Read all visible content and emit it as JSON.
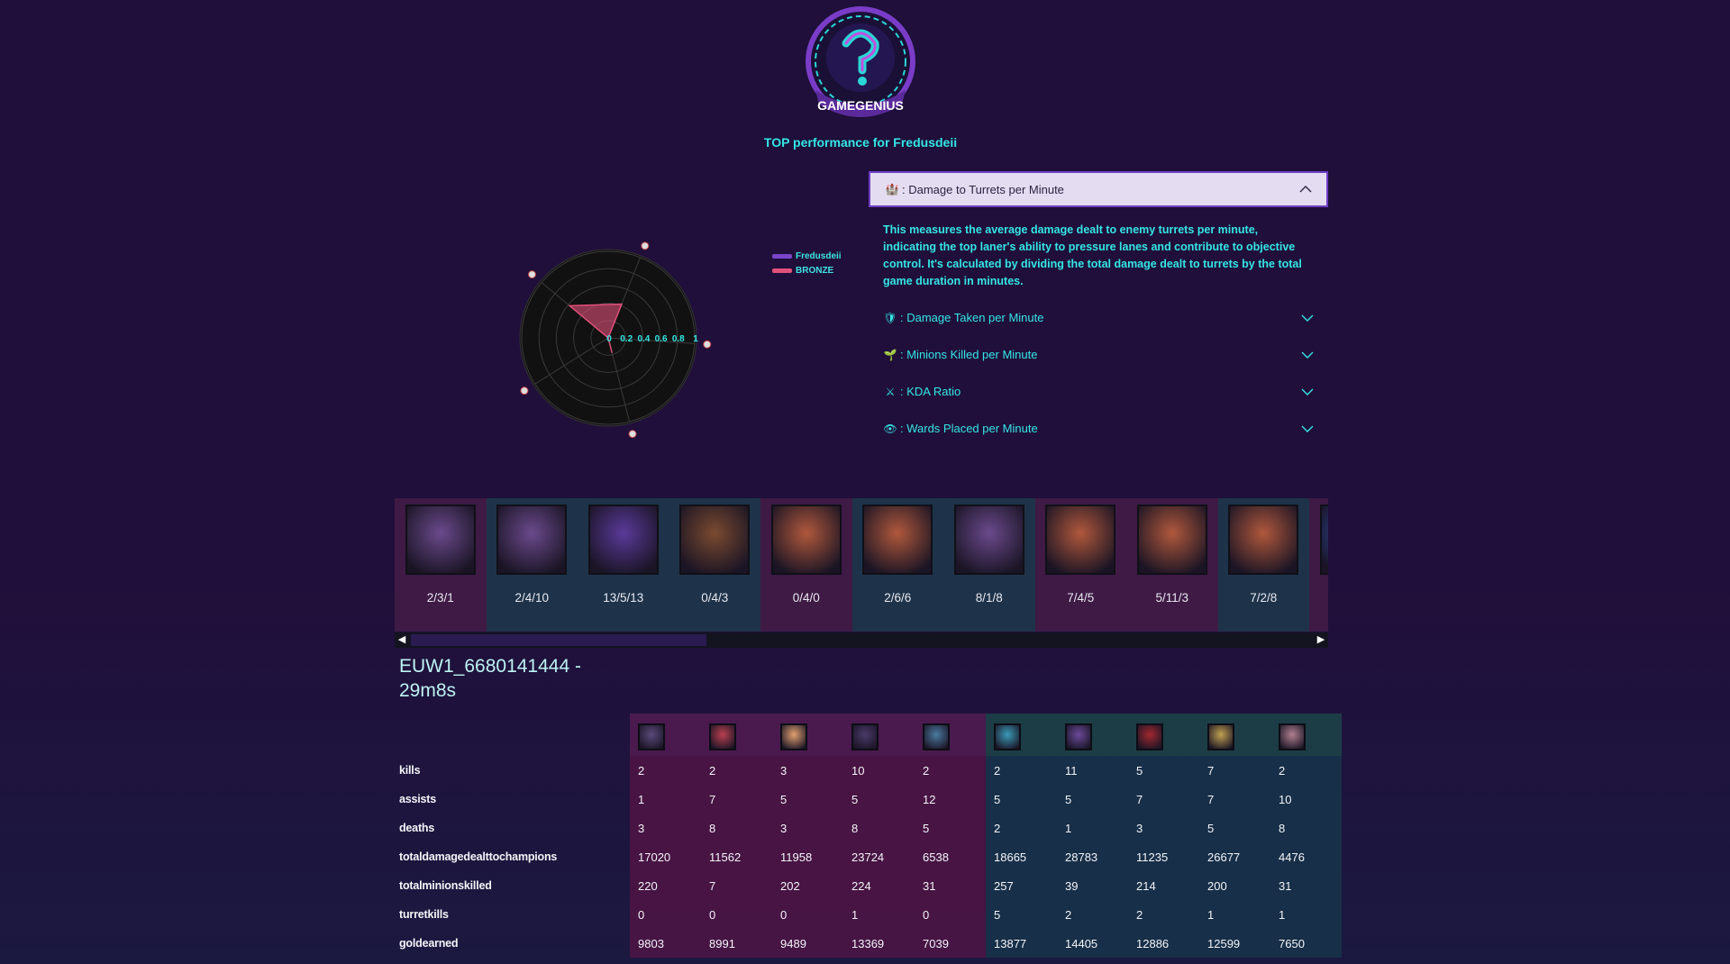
{
  "brand": {
    "logo_text": "GAMEGENIUS"
  },
  "subtitle": "TOP performance for Fredusdeii",
  "radar": {
    "axes": [
      {
        "icon": "shield-icon",
        "value": 0.42
      },
      {
        "icon": "turret-icon",
        "value": 0.0
      },
      {
        "icon": "eye-icon",
        "value": 0.18
      },
      {
        "icon": "swords-icon",
        "value": 0.0
      },
      {
        "icon": "minion-icon",
        "value": 0.58
      }
    ],
    "tick_labels": [
      "0",
      "0.2",
      "0.4",
      "0.6",
      "0.8",
      "1"
    ],
    "series_color": "#e0507a"
  },
  "legend": [
    {
      "name": "Fredusdeii",
      "color": "#7a45c8"
    },
    {
      "name": "BRONZE",
      "color": "#e0507a"
    }
  ],
  "accordion": {
    "open": {
      "icon": "turret-icon",
      "title": ": Damage to Turrets per Minute",
      "body": "This measures the average damage dealt to enemy turrets per minute, indicating the top laner's ability to pressure lanes and contribute to objective control. It's calculated by dividing the total damage dealt to turrets by the total game duration in minutes."
    },
    "items": [
      {
        "icon": "shield-icon",
        "glyph": "🛡",
        "label": ": Damage Taken per Minute"
      },
      {
        "icon": "minion-icon",
        "glyph": "🌱",
        "label": ": Minions Killed per Minute"
      },
      {
        "icon": "swords-icon",
        "glyph": "⚔",
        "label": ": KDA Ratio"
      },
      {
        "icon": "eye-icon",
        "glyph": "👁",
        "label": ": Wards Placed per Minute"
      }
    ]
  },
  "matches": [
    {
      "kda": "2/3/1",
      "result": "loss",
      "champ_color": "#6a4a8c"
    },
    {
      "kda": "2/4/10",
      "result": "win",
      "champ_color": "#6a4a8c"
    },
    {
      "kda": "13/5/13",
      "result": "win",
      "champ_color": "#5a3a9a"
    },
    {
      "kda": "0/4/3",
      "result": "win",
      "champ_color": "#7a4a30"
    },
    {
      "kda": "0/4/0",
      "result": "loss",
      "champ_color": "#b0583c"
    },
    {
      "kda": "2/6/6",
      "result": "win",
      "champ_color": "#b0583c"
    },
    {
      "kda": "8/1/8",
      "result": "win",
      "champ_color": "#6a4a8c"
    },
    {
      "kda": "7/4/5",
      "result": "loss",
      "champ_color": "#b0583c"
    },
    {
      "kda": "5/11/3",
      "result": "loss",
      "champ_color": "#b0583c"
    },
    {
      "kda": "7/2/8",
      "result": "win",
      "champ_color": "#b0583c"
    },
    {
      "kda": "",
      "result": "loss",
      "champ_color": "#2f4fb0"
    }
  ],
  "match_title": "EUW1_6680141444 - 29m8s",
  "table": {
    "champions": [
      {
        "team": "red",
        "color": "#5a4a7a"
      },
      {
        "team": "red",
        "color": "#b84050"
      },
      {
        "team": "red",
        "color": "#e0a070"
      },
      {
        "team": "red",
        "color": "#4a3a6a"
      },
      {
        "team": "red",
        "color": "#4a7aa0"
      },
      {
        "team": "blue",
        "color": "#3a9ab8"
      },
      {
        "team": "blue",
        "color": "#6a4a9a"
      },
      {
        "team": "blue",
        "color": "#a02830"
      },
      {
        "team": "blue",
        "color": "#c0a050"
      },
      {
        "team": "blue",
        "color": "#b08090"
      }
    ],
    "rows": [
      {
        "label": "kills",
        "values": [
          "2",
          "2",
          "3",
          "10",
          "2",
          "2",
          "11",
          "5",
          "7",
          "2"
        ]
      },
      {
        "label": "assists",
        "values": [
          "1",
          "7",
          "5",
          "5",
          "12",
          "5",
          "5",
          "7",
          "7",
          "10"
        ]
      },
      {
        "label": "deaths",
        "values": [
          "3",
          "8",
          "3",
          "8",
          "5",
          "2",
          "1",
          "3",
          "5",
          "8"
        ]
      },
      {
        "label": "totaldamagedealttochampions",
        "values": [
          "17020",
          "11562",
          "11958",
          "23724",
          "6538",
          "18665",
          "28783",
          "11235",
          "26677",
          "4476"
        ]
      },
      {
        "label": "totalminionskilled",
        "values": [
          "220",
          "7",
          "202",
          "224",
          "31",
          "257",
          "39",
          "214",
          "200",
          "31"
        ]
      },
      {
        "label": "turretkills",
        "values": [
          "0",
          "0",
          "0",
          "1",
          "0",
          "5",
          "2",
          "2",
          "1",
          "1"
        ]
      },
      {
        "label": "goldearned",
        "values": [
          "9803",
          "8991",
          "9489",
          "13369",
          "7039",
          "13877",
          "14405",
          "12886",
          "12599",
          "7650"
        ]
      }
    ]
  }
}
